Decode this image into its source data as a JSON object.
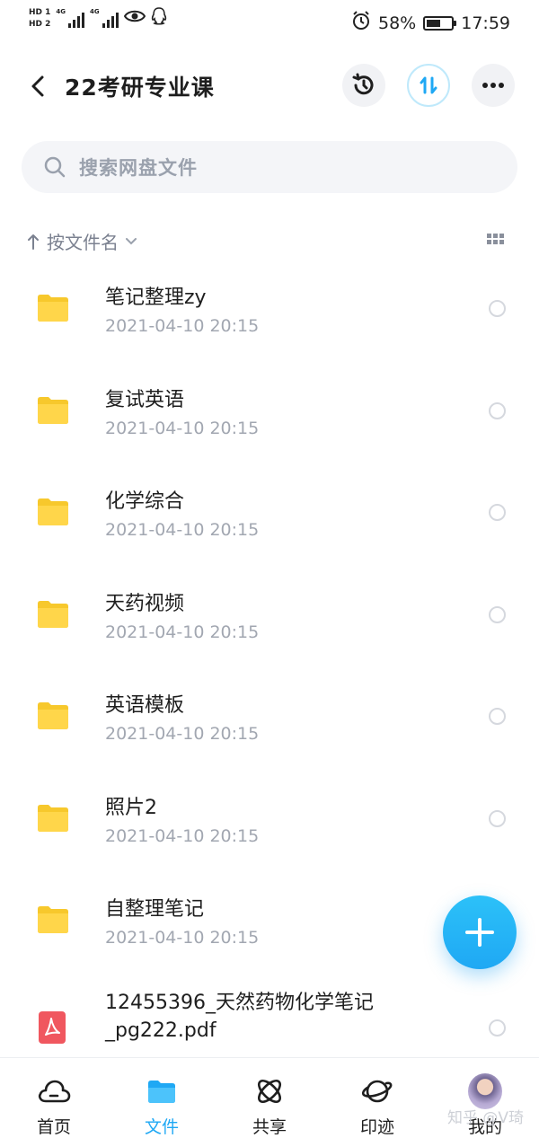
{
  "status_bar": {
    "sim1": "HD 1",
    "sim2": "HD 2",
    "net1": "4G",
    "net2": "4G",
    "battery_percent": "58%",
    "battery_level": 0.58,
    "time": "17:59"
  },
  "header": {
    "title": "22考研专业课"
  },
  "search": {
    "placeholder": "搜索网盘文件"
  },
  "sort": {
    "label": "按文件名"
  },
  "files": [
    {
      "name": "笔记整理zy",
      "date": "2021-04-10  20:15",
      "type": "folder"
    },
    {
      "name": "复试英语",
      "date": "2021-04-10  20:15",
      "type": "folder"
    },
    {
      "name": "化学综合",
      "date": "2021-04-10  20:15",
      "type": "folder"
    },
    {
      "name": "天药视频",
      "date": "2021-04-10  20:15",
      "type": "folder"
    },
    {
      "name": "英语模板",
      "date": "2021-04-10  20:15",
      "type": "folder"
    },
    {
      "name": "照片2",
      "date": "2021-04-10  20:15",
      "type": "folder"
    },
    {
      "name": "自整理笔记",
      "date": "2021-04-10  20:15",
      "type": "folder"
    }
  ],
  "pdf_file": {
    "name": "12455396_天然药物化学笔记_pg222.pdf",
    "type": "pdf"
  },
  "colors": {
    "accent": "#1fa8f4",
    "folder": "#ffd64a"
  },
  "bottom_nav": {
    "items": [
      {
        "label": "首页",
        "icon": "cloud-icon"
      },
      {
        "label": "文件",
        "icon": "folder-icon"
      },
      {
        "label": "共享",
        "icon": "atom-icon"
      },
      {
        "label": "印迹",
        "icon": "planet-icon"
      },
      {
        "label": "我的",
        "icon": "avatar"
      }
    ],
    "active": "文件"
  },
  "watermark": "知乎 @V琦"
}
